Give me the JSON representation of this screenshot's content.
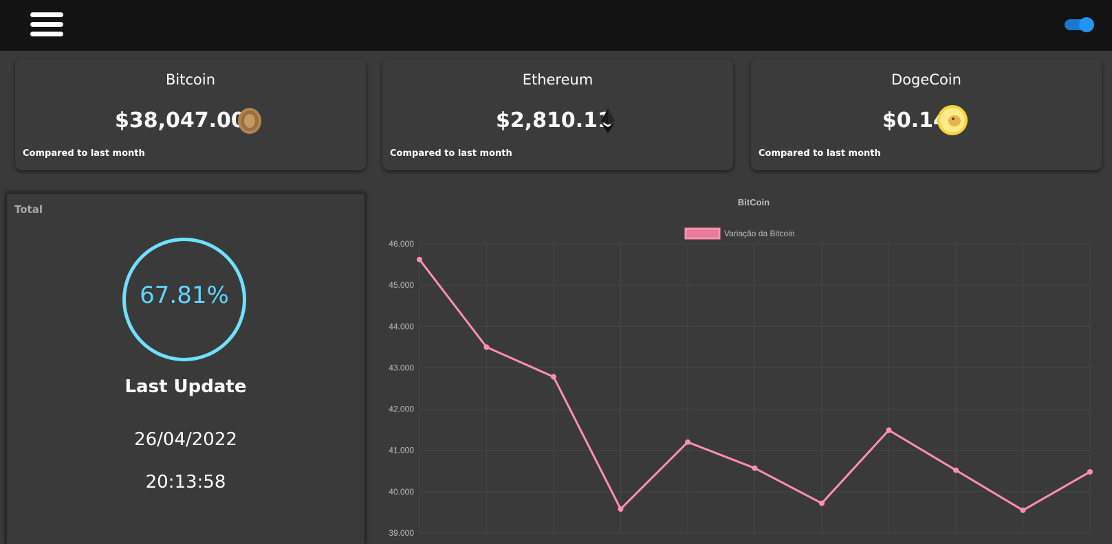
{
  "header": {
    "menu_icon": "hamburger-menu-icon",
    "theme_toggle": {
      "state": "on",
      "color": "#2196f3"
    }
  },
  "cards": [
    {
      "name": "Bitcoin",
      "price": "$38,047.00",
      "compare_text": "Compared to last month",
      "icon": "bitcoin-coin-icon"
    },
    {
      "name": "Ethereum",
      "price": "$2,810.11",
      "compare_text": "Compared to last month",
      "icon": "ethereum-icon"
    },
    {
      "name": "DogeCoin",
      "price": "$0.14",
      "compare_text": "Compared to last month",
      "icon": "dogecoin-icon"
    }
  ],
  "total_panel": {
    "label": "Total",
    "percent_text": "67.81%",
    "last_update_label": "Last Update",
    "date": "26/04/2022",
    "time": "20:13:58",
    "ring_color": "#6de2ff"
  },
  "chart_data": {
    "type": "line",
    "title": "BitCoin",
    "series": [
      {
        "name": "Variação da Bitcoin",
        "color": "#ff8fb3",
        "values": [
          45620,
          43500,
          42780,
          39580,
          41200,
          40570,
          39720,
          41490,
          40520,
          39550,
          40480
        ]
      }
    ],
    "y_ticks": [
      "46.000",
      "45.000",
      "44.000",
      "43.000",
      "42.000",
      "41.000",
      "40.000",
      "39.000"
    ],
    "ylim": [
      39000,
      46000
    ],
    "grid": true,
    "legend": "top"
  }
}
